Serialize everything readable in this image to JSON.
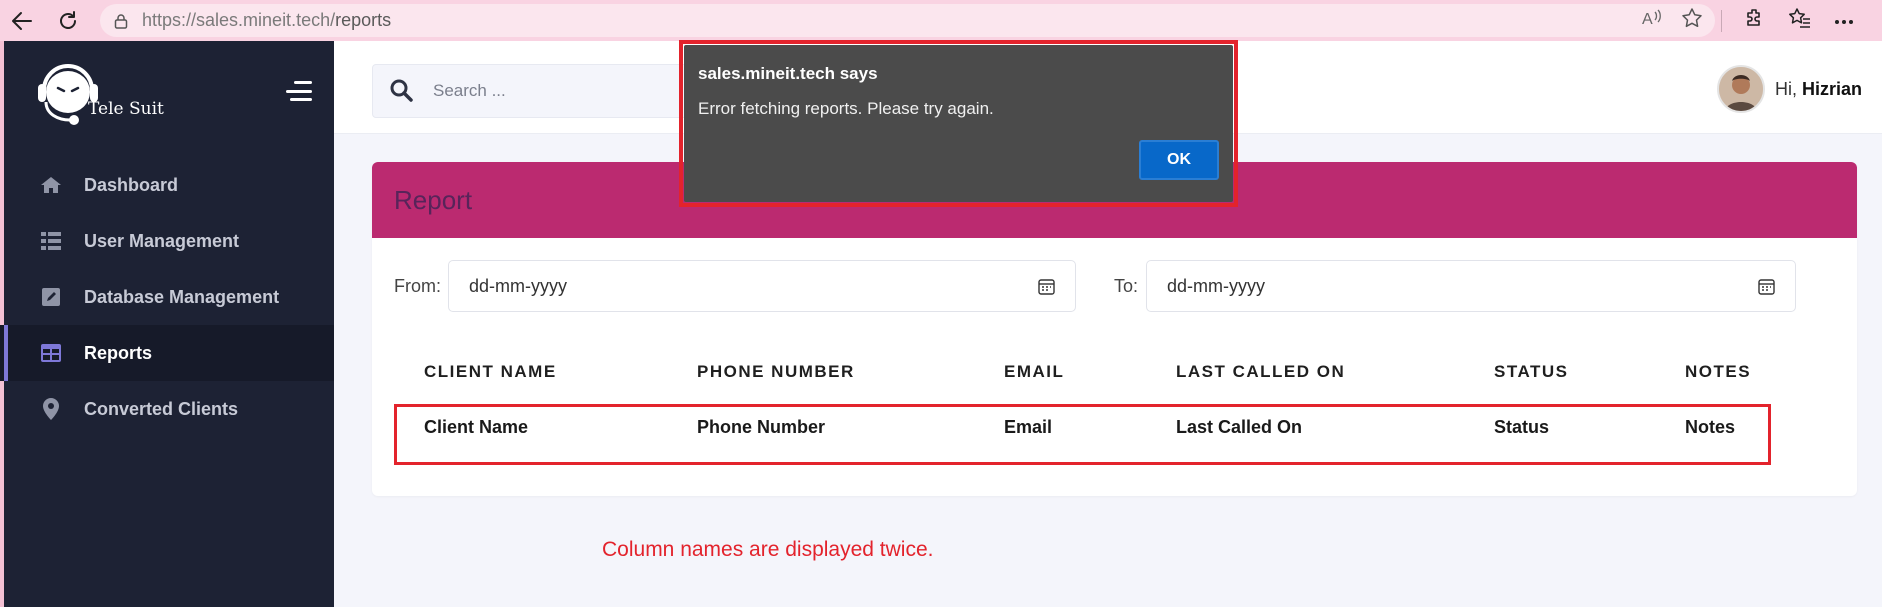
{
  "browser": {
    "url_host": "https://sales.mineit.tech/",
    "url_path": "reports",
    "icons": [
      "back-icon",
      "refresh-icon",
      "lock-icon",
      "read-aloud-icon",
      "favorite-star-icon",
      "extensions-icon",
      "favorites-icon",
      "more-icon"
    ]
  },
  "brand": {
    "name": "Tele Suit"
  },
  "sidebar": {
    "items": [
      {
        "label": "Dashboard",
        "icon": "home-icon",
        "active": false
      },
      {
        "label": "User Management",
        "icon": "list-icon",
        "active": false
      },
      {
        "label": "Database Management",
        "icon": "edit-icon",
        "active": false
      },
      {
        "label": "Reports",
        "icon": "table-icon",
        "active": true
      },
      {
        "label": "Converted Clients",
        "icon": "location-pin-icon",
        "active": false
      }
    ]
  },
  "header": {
    "search_placeholder": "Search ...",
    "greeting": "Hi,",
    "user_name": "Hizrian"
  },
  "report": {
    "title": "Report",
    "from_label": "From:",
    "from_value": "dd-mm-yyyy",
    "to_label": "To:",
    "to_value": "dd-mm-yyyy",
    "columns": [
      "CLIENT NAME",
      "PHONE NUMBER",
      "EMAIL",
      "LAST CALLED ON",
      "STATUS",
      "NOTES"
    ],
    "row": [
      "Client Name",
      "Phone Number",
      "Email",
      "Last Called On",
      "Status",
      "Notes"
    ]
  },
  "dialog": {
    "title": "sales.mineit.tech says",
    "message": "Error fetching reports. Please try again.",
    "ok_label": "OK"
  },
  "annotation": "Column names are displayed twice.",
  "colors": {
    "sidebar_bg": "#1d2234",
    "card_header": "#bb2a70",
    "dialog_bg": "#4b4b4b",
    "ok_button": "#0868c9",
    "highlight_red": "#e3232c"
  }
}
